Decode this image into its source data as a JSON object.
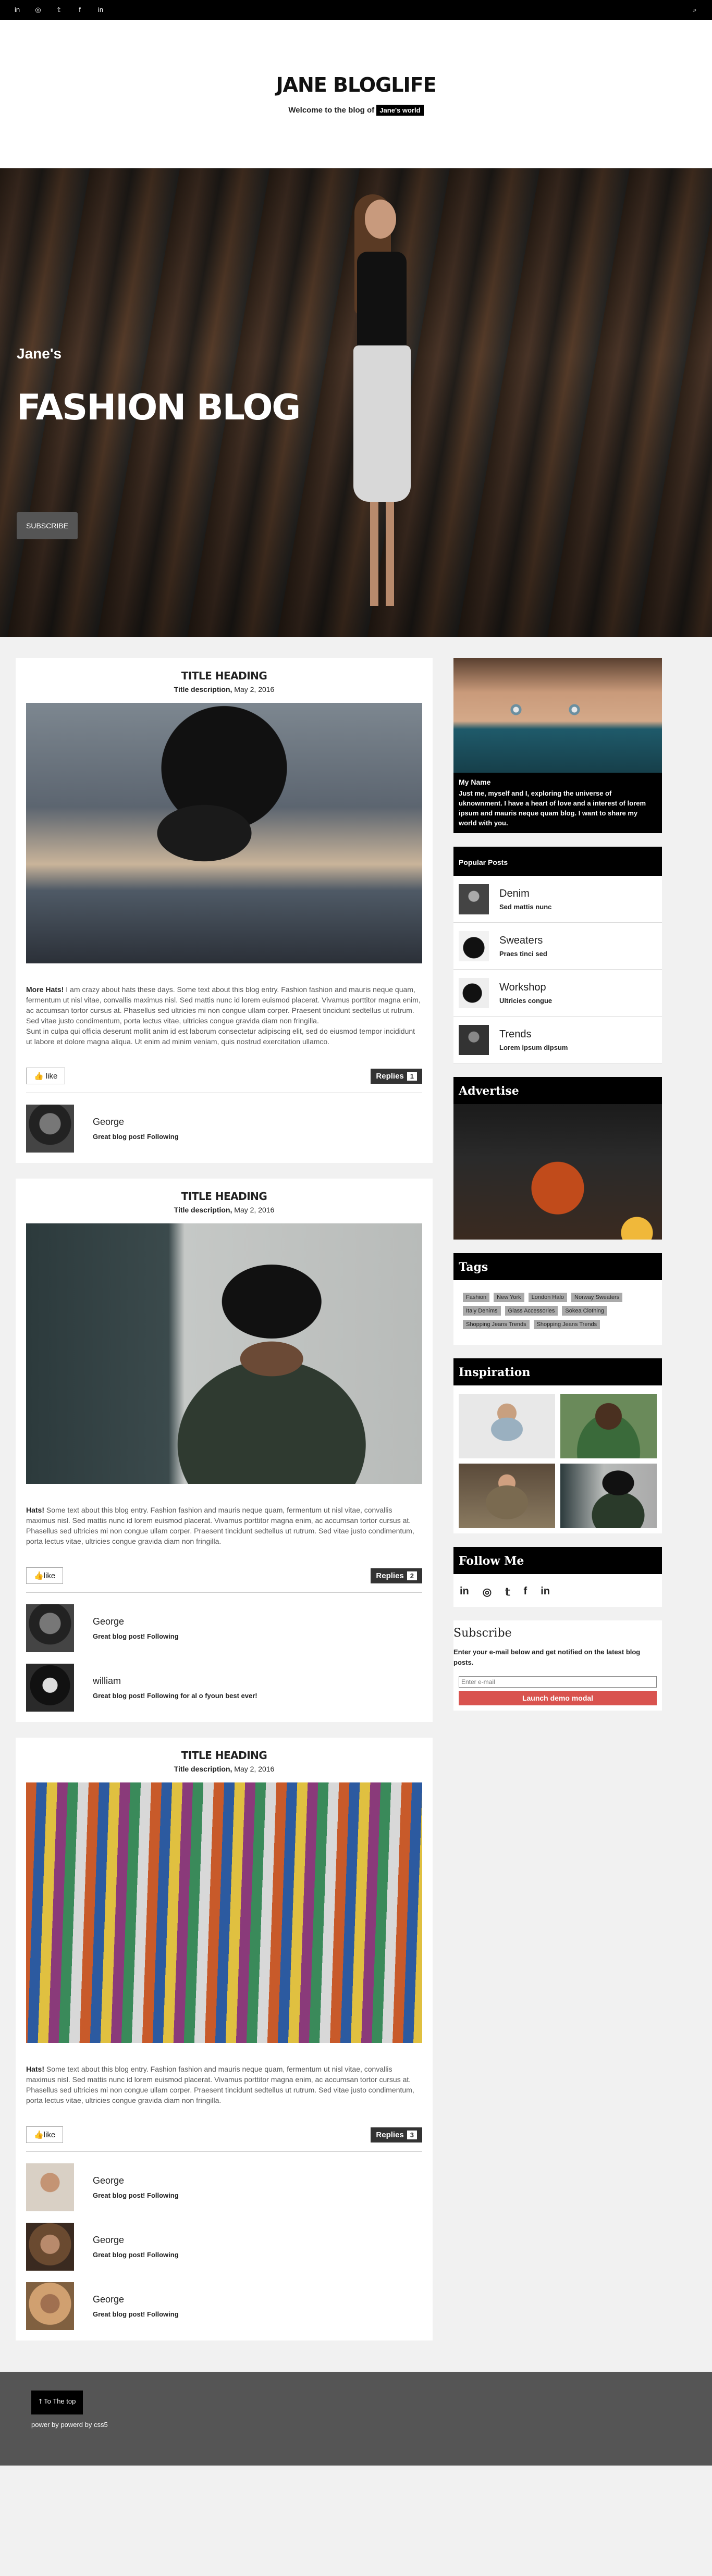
{
  "topbar": {
    "socials": [
      {
        "icon": "linkedin-icon",
        "glyph": "in"
      },
      {
        "icon": "instagram-icon",
        "glyph": "◎"
      },
      {
        "icon": "twitter-icon",
        "glyph": "𝕥"
      },
      {
        "icon": "facebook-icon",
        "glyph": "f"
      },
      {
        "icon": "linkedin-icon-2",
        "glyph": "in"
      }
    ],
    "search_glyph": "⌕"
  },
  "header": {
    "title": "JANE BLOGLIFE",
    "tagline_prefix": "Welcome to the blog of",
    "tagline_highlight": "Jane's world"
  },
  "hero": {
    "small": "Jane's",
    "big": "FASHION BLOG",
    "button": "SUBSCRIBE"
  },
  "posts": [
    {
      "title": "TITLE HEADING",
      "desc_bold": "Title description,",
      "date": "May 2, 2016",
      "body_bold": "More Hats!",
      "body": " I am crazy about hats these days. Some text about this blog entry. Fashion fashion and mauris neque quam, fermentum ut nisl vitae, convallis maximus nisl. Sed mattis nunc id lorem euismod placerat. Vivamus porttitor magna enim, ac accumsan tortor cursus at. Phasellus sed ultricies mi non congue ullam corper. Praesent tincidunt sedtellus ut rutrum. Sed vitae justo condimentum, porta lectus vitae, ultricies congue gravida diam non fringilla.",
      "body2": "Sunt in culpa qui officia deserunt mollit anim id est laborum consectetur adipiscing elit, sed do eiusmod tempor incididunt ut labore et dolore magna aliqua. Ut enim ad minim veniam, quis nostrud exercitation ullamco.",
      "like": "like",
      "replies_label": "Replies",
      "replies_count": "1",
      "comments": [
        {
          "name": "George",
          "text": "Great blog post! Following"
        }
      ]
    },
    {
      "title": "TITLE HEADING",
      "desc_bold": "Title description,",
      "date": "May 2, 2016",
      "body_bold": "Hats!",
      "body": " Some text about this blog entry. Fashion fashion and mauris neque quam, fermentum ut nisl vitae, convallis maximus nisl. Sed mattis nunc id lorem euismod placerat. Vivamus porttitor magna enim, ac accumsan tortor cursus at. Phasellus sed ultricies mi non congue ullam corper. Praesent tincidunt sedtellus ut rutrum. Sed vitae justo condimentum, porta lectus vitae, ultricies congue gravida diam non fringilla.",
      "body2": "",
      "like": "like",
      "replies_label": "Replies",
      "replies_count": "2",
      "comments": [
        {
          "name": "George",
          "text": "Great blog post! Following"
        },
        {
          "name": "william",
          "text": "Great blog post! Following for al o fyoun best ever!"
        }
      ]
    },
    {
      "title": "TITLE HEADING",
      "desc_bold": "Title description,",
      "date": "May 2, 2016",
      "body_bold": "Hats!",
      "body": " Some text about this blog entry. Fashion fashion and mauris neque quam, fermentum ut nisl vitae, convallis maximus nisl. Sed mattis nunc id lorem euismod placerat. Vivamus porttitor magna enim, ac accumsan tortor cursus at. Phasellus sed ultricies mi non congue ullam corper. Praesent tincidunt sedtellus ut rutrum. Sed vitae justo condimentum, porta lectus vitae, ultricies congue gravida diam non fringilla.",
      "body2": "",
      "like": "like",
      "replies_label": "Replies",
      "replies_count": "3",
      "comments": [
        {
          "name": "George",
          "text": "Great blog post! Following"
        },
        {
          "name": "George",
          "text": "Great blog post! Following"
        },
        {
          "name": "George",
          "text": "Great blog post! Following"
        }
      ]
    }
  ],
  "sidebar": {
    "about": {
      "name": "My Name",
      "bio": "Just me, myself and I, exploring the universe of uknownment. I have a heart of love and a interest of lorem ipsum and mauris neque quam blog. I want to share my world with you."
    },
    "popular": {
      "title": "Popular Posts",
      "items": [
        {
          "title": "Denim",
          "sub": "Sed mattis nunc"
        },
        {
          "title": "Sweaters",
          "sub": "Praes tinci sed"
        },
        {
          "title": "Workshop",
          "sub": "Ultricies congue"
        },
        {
          "title": "Trends",
          "sub": "Lorem ipsum dipsum"
        }
      ]
    },
    "advertise": "Advertise",
    "tags": {
      "title": "Tags",
      "items": [
        "Fashion",
        "New York",
        "London Halo",
        "Norway Sweaters",
        "Italy Denims",
        "Glass Accessories",
        "Sokea Clothing",
        "Shopping Jeans Trends",
        "Shopping Jeans Trends"
      ]
    },
    "inspiration": "Inspiration",
    "follow": {
      "title": "Follow Me",
      "icons": [
        {
          "icon": "linkedin-icon",
          "glyph": "in"
        },
        {
          "icon": "instagram-icon",
          "glyph": "◎"
        },
        {
          "icon": "twitter-icon",
          "glyph": "𝕥"
        },
        {
          "icon": "facebook-icon",
          "glyph": "f"
        },
        {
          "icon": "linkedin-icon-2",
          "glyph": "in"
        }
      ]
    },
    "subscribe": {
      "title": "Subscribe",
      "text": "Enter your e-mail below and get notified on the latest blog posts.",
      "placeholder": "Enter e-mail",
      "button": "Launch demo modal"
    }
  },
  "footer": {
    "to_top": "To The top",
    "powered": "power by  powerd by css5"
  },
  "colors": {
    "accent": "#d9534f",
    "dark": "#000000",
    "footer": "#555555"
  }
}
